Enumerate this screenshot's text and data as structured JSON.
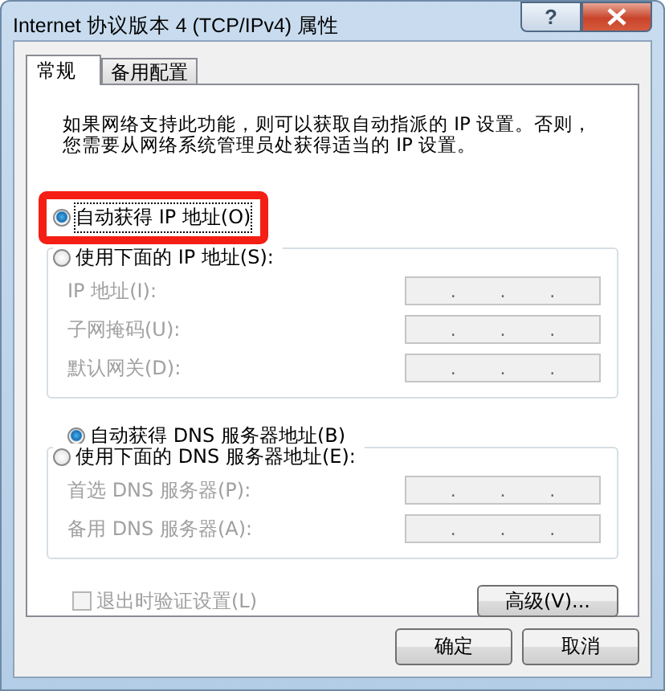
{
  "window": {
    "title": "Internet 协议版本 4 (TCP/IPv4) 属性",
    "help_button": "?"
  },
  "tabs": [
    {
      "label": "常规",
      "selected": true
    },
    {
      "label": "备用配置",
      "selected": false
    }
  ],
  "description": [
    "如果网络支持此功能，则可以获取自动指派的 IP 设置。否则，",
    "您需要从网络系统管理员处获得适当的 IP 设置。"
  ],
  "ip": {
    "auto_option": {
      "label": "自动获得 IP 地址(O)",
      "selected": true,
      "highlighted": true
    },
    "manual_option": {
      "label": "使用下面的 IP 地址(S):",
      "selected": false
    },
    "fields": [
      {
        "label": "IP 地址(I):",
        "disabled": true,
        "separators": [
          ".",
          ".",
          "."
        ]
      },
      {
        "label": "子网掩码(U):",
        "disabled": true,
        "separators": [
          ".",
          ".",
          "."
        ]
      },
      {
        "label": "默认网关(D):",
        "disabled": true,
        "separators": [
          ".",
          ".",
          "."
        ]
      }
    ]
  },
  "dns": {
    "auto_option": {
      "label": "自动获得 DNS 服务器地址(B)",
      "selected": true,
      "highlighted": false
    },
    "manual_option": {
      "label": "使用下面的 DNS 服务器地址(E):",
      "selected": false
    },
    "fields": [
      {
        "label": "首选 DNS 服务器(P):",
        "disabled": true,
        "separators": [
          ".",
          ".",
          "."
        ]
      },
      {
        "label": "备用 DNS 服务器(A):",
        "disabled": true,
        "separators": [
          ".",
          ".",
          "."
        ]
      }
    ]
  },
  "validate": {
    "label": "退出时验证设置(L)",
    "checked": false,
    "disabled": true
  },
  "advanced_button": "高级(V)...",
  "buttons": [
    "确定",
    "取消"
  ]
}
